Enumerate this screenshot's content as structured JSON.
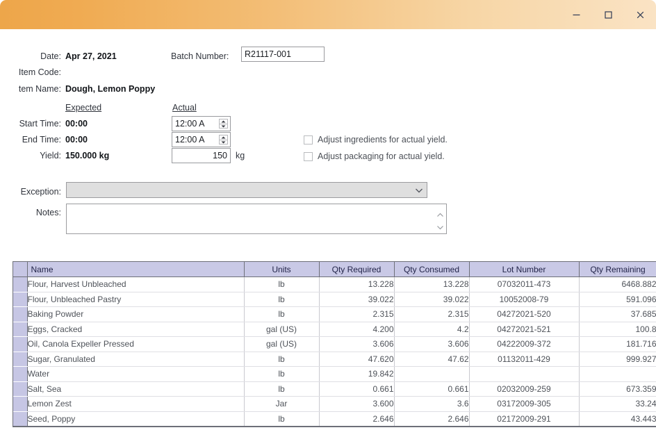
{
  "titlebar": {
    "minimize_label": "Minimize",
    "maximize_label": "Maximize",
    "close_label": "Close"
  },
  "form": {
    "date_label": "Date:",
    "date_value": "Apr 27, 2021",
    "batch_number_label": "Batch Number:",
    "batch_number_value": "R21117-001",
    "item_code_label": "Item Code:",
    "item_code_value": "",
    "item_name_label": "tem Name:",
    "item_name_value": "Dough, Lemon Poppy",
    "expected_header": "Expected",
    "actual_header": "Actual",
    "start_time_label": "Start Time:",
    "start_time_expected": "00:00",
    "start_time_actual": "12:00 A",
    "end_time_label": "End Time:",
    "end_time_expected": "00:00",
    "end_time_actual": "12:00 A",
    "yield_label": "Yield:",
    "yield_expected": "150.000 kg",
    "yield_actual": "150",
    "yield_units": "kg",
    "adjust_ingredients_label": "Adjust ingredients for actual yield.",
    "adjust_packaging_label": "Adjust packaging for actual yield.",
    "exception_label": "Exception:",
    "exception_value": "",
    "exception_browse_label": "...",
    "notes_label": "Notes:",
    "notes_value": ""
  },
  "grid": {
    "columns": [
      "Name",
      "Units",
      "Qty Required",
      "Qty Consumed",
      "Lot Number",
      "Qty Remaining"
    ],
    "rows": [
      {
        "name": "Flour, Harvest Unbleached",
        "units": "lb",
        "qty_required": "13.228",
        "qty_consumed": "13.228",
        "lot_number": "07032011-473",
        "qty_remaining": "6468.882"
      },
      {
        "name": "Flour, Unbleached Pastry",
        "units": "lb",
        "qty_required": "39.022",
        "qty_consumed": "39.022",
        "lot_number": "10052008-79",
        "qty_remaining": "591.096"
      },
      {
        "name": "Baking Powder",
        "units": "lb",
        "qty_required": "2.315",
        "qty_consumed": "2.315",
        "lot_number": "04272021-520",
        "qty_remaining": "37.685"
      },
      {
        "name": "Eggs, Cracked",
        "units": "gal (US)",
        "qty_required": "4.200",
        "qty_consumed": "4.2",
        "lot_number": "04272021-521",
        "qty_remaining": "100.8"
      },
      {
        "name": "Oil, Canola Expeller Pressed",
        "units": "gal (US)",
        "qty_required": "3.606",
        "qty_consumed": "3.606",
        "lot_number": "04222009-372",
        "qty_remaining": "181.716"
      },
      {
        "name": "Sugar, Granulated",
        "units": "lb",
        "qty_required": "47.620",
        "qty_consumed": "47.62",
        "lot_number": "01132011-429",
        "qty_remaining": "999.927"
      },
      {
        "name": "Water",
        "units": "lb",
        "qty_required": "19.842",
        "qty_consumed": "",
        "lot_number": "",
        "qty_remaining": ""
      },
      {
        "name": "Salt, Sea",
        "units": "lb",
        "qty_required": "0.661",
        "qty_consumed": "0.661",
        "lot_number": "02032009-259",
        "qty_remaining": "673.359"
      },
      {
        "name": "Lemon Zest",
        "units": "Jar",
        "qty_required": "3.600",
        "qty_consumed": "3.6",
        "lot_number": "03172009-305",
        "qty_remaining": "33.24"
      },
      {
        "name": "Seed, Poppy",
        "units": "lb",
        "qty_required": "2.646",
        "qty_consumed": "2.646",
        "lot_number": "02172009-291",
        "qty_remaining": "43.443"
      }
    ]
  },
  "colors": {
    "titlebar_start": "#eda64a",
    "titlebar_end": "#fae3c4",
    "grid_header_bg": "#c9c9e6",
    "grid_header_text": "#222449",
    "selector_col_bg": "#c6c6e4"
  }
}
